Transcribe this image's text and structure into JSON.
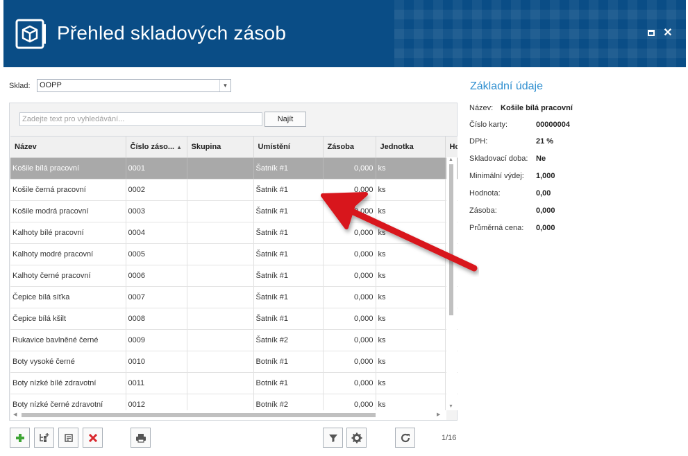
{
  "header": {
    "title": "Přehled skladových zásob"
  },
  "sklad": {
    "label": "Sklad:",
    "value": "OOPP"
  },
  "search": {
    "placeholder": "Zadejte text pro vyhledávání...",
    "find_label": "Najít"
  },
  "table": {
    "columns": [
      "Název",
      "Číslo záso...",
      "Skupina",
      "Umístění",
      "Zásoba",
      "Jednotka",
      "Ho"
    ],
    "rows": [
      [
        "Košile bílá pracovní",
        "0001",
        "",
        "Šatník #1",
        "0,000",
        "ks"
      ],
      [
        "Košile černá pracovní",
        "0002",
        "",
        "Šatník #1",
        "0,000",
        "ks"
      ],
      [
        "Košile modrá pracovní",
        "0003",
        "",
        "Šatník #1",
        "0,000",
        "ks"
      ],
      [
        "Kalhoty bílé pracovní",
        "0004",
        "",
        "Šatník #1",
        "0,000",
        "ks"
      ],
      [
        "Kalhoty modré pracovní",
        "0005",
        "",
        "Šatník #1",
        "0,000",
        "ks"
      ],
      [
        "Kalhoty černé pracovní",
        "0006",
        "",
        "Šatník #1",
        "0,000",
        "ks"
      ],
      [
        "Čepice bílá síťka",
        "0007",
        "",
        "Šatník #1",
        "0,000",
        "ks"
      ],
      [
        "Čepice bílá kšilt",
        "0008",
        "",
        "Šatník #1",
        "0,000",
        "ks"
      ],
      [
        "Rukavice bavlněné černé",
        "0009",
        "",
        "Šatník #2",
        "0,000",
        "ks"
      ],
      [
        "Boty vysoké černé",
        "0010",
        "",
        "Botník #1",
        "0,000",
        "ks"
      ],
      [
        "Boty nízké bílé zdravotní",
        "0011",
        "",
        "Botník #1",
        "0,000",
        "ks"
      ],
      [
        "Boty nízké černé zdravotní",
        "0012",
        "",
        "Botník #2",
        "0,000",
        "ks"
      ]
    ],
    "selected_row": 0
  },
  "toolbar": {
    "buttons": [
      "add-icon",
      "add-child-icon",
      "edit-icon",
      "delete-icon",
      "print-icon",
      "filter-icon",
      "settings-icon",
      "refresh-icon"
    ],
    "pager": "1/16"
  },
  "detail": {
    "title": "Základní údaje",
    "fields": [
      {
        "label": "Název:",
        "value": "Košile bílá pracovní"
      },
      {
        "label": "Číslo karty:",
        "value": "00000004"
      },
      {
        "label": "DPH:",
        "value": "21 %"
      },
      {
        "label": "Skladovací doba:",
        "value": "Ne"
      },
      {
        "label": "Minimální výdej:",
        "value": "1,000"
      },
      {
        "label": "Hodnota:",
        "value": "0,00"
      },
      {
        "label": "Zásoba:",
        "value": "0,000"
      },
      {
        "label": "Průměrná cena:",
        "value": "0,000"
      }
    ]
  },
  "colors": {
    "header_bg": "#0a4d86",
    "accent": "#2f8fd0",
    "selected_row": "#a9a9a9",
    "add_green": "#3fa535",
    "delete_red": "#d9262c",
    "annotation_red": "#d8141e"
  }
}
